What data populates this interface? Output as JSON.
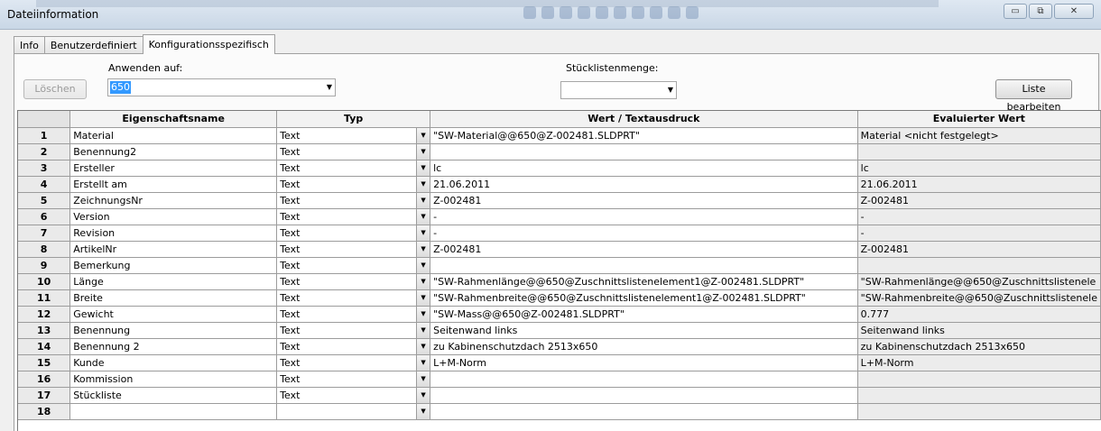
{
  "window": {
    "title": "Dateiinformation",
    "minimize_glyph": "▭",
    "restore_glyph": "⧉",
    "close_glyph": "✕"
  },
  "tabs": [
    {
      "label": "Info",
      "active": false
    },
    {
      "label": "Benutzerdefiniert",
      "active": false
    },
    {
      "label": "Konfigurationsspezifisch",
      "active": true
    }
  ],
  "toolbar": {
    "apply_to_label": "Anwenden auf:",
    "apply_to_value": "650",
    "delete_button": "Löschen",
    "bom_qty_label": "Stücklistenmenge:",
    "bom_qty_value": "",
    "edit_list_button": "Liste bearbeiten"
  },
  "grid": {
    "headers": {
      "name": "Eigenschaftsname",
      "type": "Typ",
      "value": "Wert / Textausdruck",
      "evaluated": "Evaluierter Wert"
    },
    "rows": [
      {
        "num": "1",
        "name": "Material",
        "type": "Text",
        "value": "\"SW-Material@@650@Z-002481.SLDPRT\"",
        "evaluated": "Material <nicht festgelegt>"
      },
      {
        "num": "2",
        "name": "Benennung2",
        "type": "Text",
        "value": "",
        "evaluated": ""
      },
      {
        "num": "3",
        "name": "Ersteller",
        "type": "Text",
        "value": "lc",
        "evaluated": "lc"
      },
      {
        "num": "4",
        "name": "Erstellt am",
        "type": "Text",
        "value": "21.06.2011",
        "evaluated": "21.06.2011"
      },
      {
        "num": "5",
        "name": "ZeichnungsNr",
        "type": "Text",
        "value": "Z-002481",
        "evaluated": "Z-002481"
      },
      {
        "num": "6",
        "name": "Version",
        "type": "Text",
        "value": "-",
        "evaluated": "-"
      },
      {
        "num": "7",
        "name": "Revision",
        "type": "Text",
        "value": "-",
        "evaluated": "-"
      },
      {
        "num": "8",
        "name": "ArtikelNr",
        "type": "Text",
        "value": "Z-002481",
        "evaluated": "Z-002481"
      },
      {
        "num": "9",
        "name": "Bemerkung",
        "type": "Text",
        "value": "",
        "evaluated": ""
      },
      {
        "num": "10",
        "name": "Länge",
        "type": "Text",
        "value": "\"SW-Rahmenlänge@@650@Zuschnittslistenelement1@Z-002481.SLDPRT\"",
        "evaluated": "\"SW-Rahmenlänge@@650@Zuschnittslistenele"
      },
      {
        "num": "11",
        "name": "Breite",
        "type": "Text",
        "value": "\"SW-Rahmenbreite@@650@Zuschnittslistenelement1@Z-002481.SLDPRT\"",
        "evaluated": "\"SW-Rahmenbreite@@650@Zuschnittslistenele"
      },
      {
        "num": "12",
        "name": "Gewicht",
        "type": "Text",
        "value": "\"SW-Mass@@650@Z-002481.SLDPRT\"",
        "evaluated": "0.777"
      },
      {
        "num": "13",
        "name": "Benennung",
        "type": "Text",
        "value": "Seitenwand links",
        "evaluated": "Seitenwand links"
      },
      {
        "num": "14",
        "name": "Benennung 2",
        "type": "Text",
        "value": "zu Kabinenschutzdach 2513x650",
        "evaluated": "zu Kabinenschutzdach 2513x650"
      },
      {
        "num": "15",
        "name": "Kunde",
        "type": "Text",
        "value": "L+M-Norm",
        "evaluated": "L+M-Norm"
      },
      {
        "num": "16",
        "name": "Kommission",
        "type": "Text",
        "value": "",
        "evaluated": ""
      },
      {
        "num": "17",
        "name": "Stückliste",
        "type": "Text",
        "value": "",
        "evaluated": ""
      },
      {
        "num": "18",
        "name": "",
        "type": "",
        "value": "",
        "evaluated": ""
      }
    ]
  },
  "icons": {
    "dropdown": "chevron-down-icon"
  }
}
